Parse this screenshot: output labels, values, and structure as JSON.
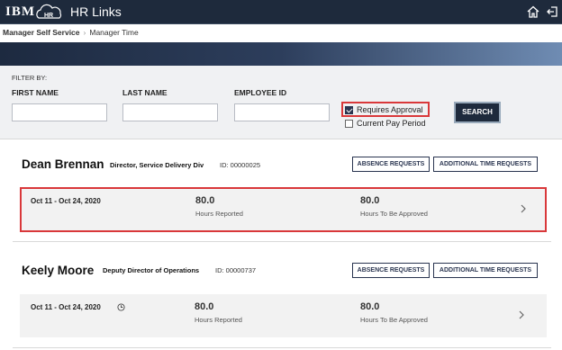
{
  "header": {
    "brand": "IBM",
    "app_title": "HR Links",
    "icons": [
      "hr-logo-icon",
      "home-icon",
      "logout-icon"
    ]
  },
  "breadcrumb": {
    "first": "Manager Self Service",
    "second": "Manager Time"
  },
  "filter": {
    "heading": "FILTER BY:",
    "first_name_label": "FIRST NAME",
    "last_name_label": "LAST NAME",
    "employee_id_label": "EMPLOYEE ID",
    "first_name_value": "",
    "last_name_value": "",
    "employee_id_value": "",
    "requires_approval_label": "Requires Approval",
    "requires_approval_checked": true,
    "current_pay_period_label": "Current Pay Period",
    "current_pay_period_checked": false,
    "search_label": "SEARCH"
  },
  "employees": [
    {
      "name": "Dean Brennan",
      "title": "Director, Service Delivery Div",
      "id_text": "ID: 00000025",
      "absence_btn": "ABSENCE REQUESTS",
      "additional_btn": "ADDITIONAL TIME REQUESTS",
      "period": {
        "dates": "Oct 11 - Oct 24, 2020",
        "hours_reported": "80.0",
        "hours_reported_label": "Hours Reported",
        "hours_to_approve": "80.0",
        "hours_to_approve_label": "Hours To Be Approved"
      }
    },
    {
      "name": "Keely Moore",
      "title": "Deputy Director of Operations",
      "id_text": "ID: 00000737",
      "absence_btn": "ABSENCE REQUESTS",
      "additional_btn": "ADDITIONAL TIME REQUESTS",
      "period": {
        "dates": "Oct 11 - Oct 24, 2020",
        "hours_reported": "80.0",
        "hours_reported_label": "Hours Reported",
        "hours_to_approve": "80.0",
        "hours_to_approve_label": "Hours To Be Approved"
      }
    }
  ],
  "colors": {
    "header_bg": "#1e2a3c",
    "highlight_border": "#d9383a",
    "button_text": "#2a3550"
  }
}
